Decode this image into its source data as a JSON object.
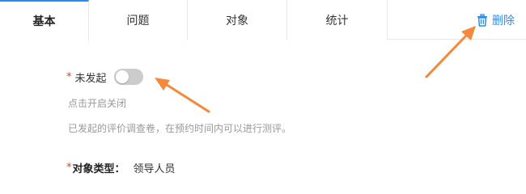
{
  "tabs": [
    {
      "label": "基本",
      "active": true
    },
    {
      "label": "问题",
      "active": false
    },
    {
      "label": "对象",
      "active": false
    },
    {
      "label": "统计",
      "active": false
    }
  ],
  "toolbar": {
    "delete_label": "删除",
    "delete_icon": "trash-icon"
  },
  "form": {
    "status": {
      "required_mark": "*",
      "label": "未发起",
      "toggle_on": false,
      "toggle_hint": "点击开启关闭",
      "description": "已发起的评价调查卷，在预约时间内可以进行测评。"
    },
    "object_type": {
      "required_mark": "*",
      "label": "对象类型：",
      "value": "领导人员"
    }
  },
  "colors": {
    "accent": "#2d8cf0",
    "required": "#ed4014",
    "toggle_off": "#cccccc",
    "hint_text": "#999999",
    "annotation_arrow": "#f5883a"
  }
}
